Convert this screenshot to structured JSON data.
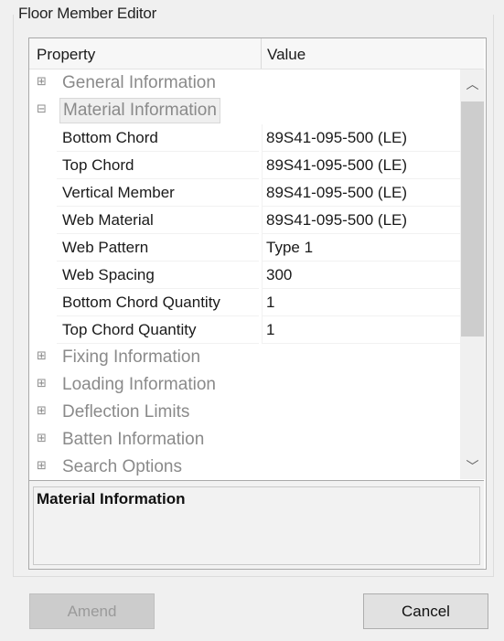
{
  "window": {
    "title": "Floor Member Editor"
  },
  "grid": {
    "headers": {
      "property": "Property",
      "value": "Value"
    },
    "categories": {
      "general": {
        "label": "General Information",
        "expander": "⊞"
      },
      "material": {
        "label": "Material Information",
        "expander": "⊟"
      },
      "fixing": {
        "label": "Fixing Information",
        "expander": "⊞"
      },
      "loading": {
        "label": "Loading Information",
        "expander": "⊞"
      },
      "deflection": {
        "label": "Deflection Limits",
        "expander": "⊞"
      },
      "batten": {
        "label": "Batten Information",
        "expander": "⊞"
      },
      "search": {
        "label": "Search Options",
        "expander": "⊞"
      }
    },
    "properties": [
      {
        "name": "Bottom Chord",
        "value": "89S41-095-500  (LE)"
      },
      {
        "name": "Top Chord",
        "value": "89S41-095-500  (LE)"
      },
      {
        "name": "Vertical Member",
        "value": "89S41-095-500  (LE)"
      },
      {
        "name": "Web Material",
        "value": "89S41-095-500  (LE)"
      },
      {
        "name": "Web Pattern",
        "value": "Type 1"
      },
      {
        "name": "Web Spacing",
        "value": "300"
      },
      {
        "name": "Bottom Chord Quantity",
        "value": "1"
      },
      {
        "name": "Top Chord Quantity",
        "value": "1"
      }
    ],
    "scroll": {
      "up_icon": "chevron-up-icon",
      "down_icon": "chevron-down-icon",
      "up_glyph": "︿",
      "down_glyph": "﹀"
    }
  },
  "description": {
    "title": "Material Information"
  },
  "buttons": {
    "amend": "Amend",
    "cancel": "Cancel"
  }
}
